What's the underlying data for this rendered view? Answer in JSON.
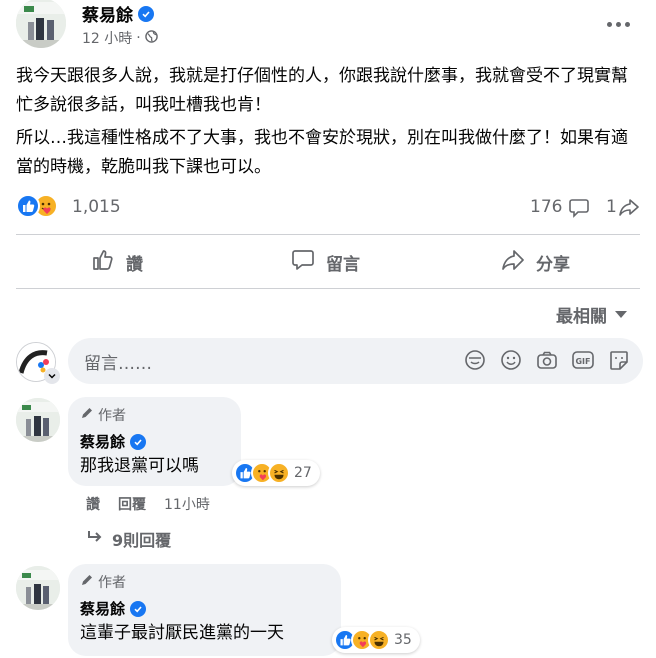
{
  "post": {
    "author": "蔡易餘",
    "time": "12 小時",
    "separator": "·",
    "paragraphs": [
      "我今天跟很多人說，我就是打仔個性的人，你跟我說什麼事，我就會受不了現實幫忙多說很多話，叫我吐槽我也肯！",
      "所以…我這種性格成不了大事，我也不會安於現狀，別在叫我做什麼了！如果有適當的時機，乾脆叫我下課也可以。"
    ],
    "reaction_count": "1,015",
    "comment_count": "176",
    "share_count": "1"
  },
  "actions": {
    "like": "讚",
    "comment": "留言",
    "share": "分享"
  },
  "sort_label": "最相關",
  "comment_box": {
    "placeholder": "留言……"
  },
  "comments": [
    {
      "author_tag": "作者",
      "author": "蔡易餘",
      "text": "那我退黨可以嗎",
      "reaction_count": "27",
      "actions": {
        "like": "讚",
        "reply": "回覆",
        "time": "11小時"
      },
      "replies_label": "9則回覆"
    },
    {
      "author_tag": "作者",
      "author": "蔡易餘",
      "text": "這輩子最討厭民進黨的一天",
      "reaction_count": "35"
    }
  ],
  "colors": {
    "accent": "#1877f2",
    "secondary_text": "#65676b",
    "bubble": "#f0f2f5",
    "divider": "#ced0d4"
  }
}
